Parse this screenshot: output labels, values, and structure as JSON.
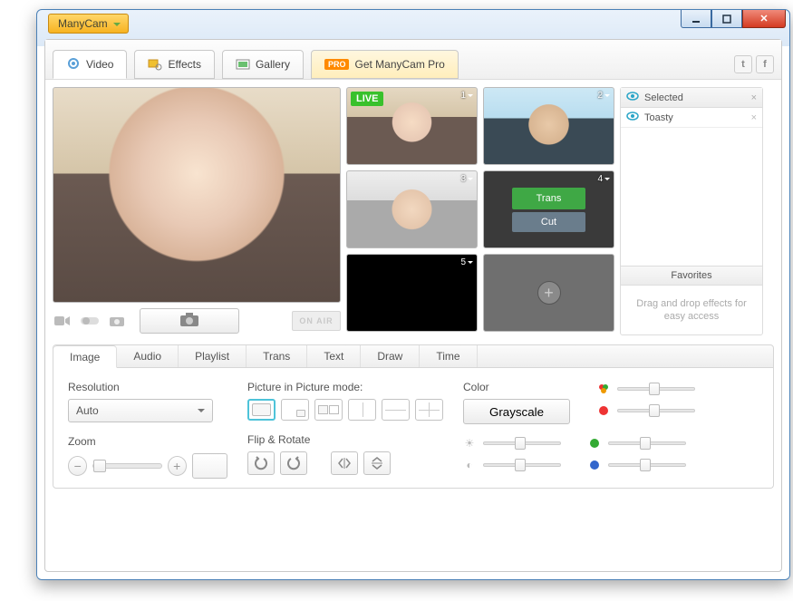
{
  "app": {
    "menu_label": "ManyCam"
  },
  "toptabs": {
    "video": "Video",
    "effects": "Effects",
    "gallery": "Gallery",
    "pro_badge": "PRO",
    "pro_label": "Get ManyCam Pro"
  },
  "thumbs": {
    "live": "LIVE",
    "n1": "1",
    "n2": "2",
    "n3": "3",
    "n4": "4",
    "n5": "5",
    "trans": "Trans",
    "cut": "Cut"
  },
  "onair": "ON AIR",
  "effects_panel": {
    "header": "Selected",
    "item1": "Toasty",
    "favorites": "Favorites",
    "drop_hint": "Drag and drop effects for easy access"
  },
  "lower_tabs": {
    "image": "Image",
    "audio": "Audio",
    "playlist": "Playlist",
    "trans": "Trans",
    "text": "Text",
    "draw": "Draw",
    "time": "Time"
  },
  "settings": {
    "resolution_label": "Resolution",
    "resolution_value": "Auto",
    "zoom_label": "Zoom",
    "pip_label": "Picture in Picture mode:",
    "flip_label": "Flip & Rotate",
    "color_label": "Color",
    "grayscale": "Grayscale"
  }
}
